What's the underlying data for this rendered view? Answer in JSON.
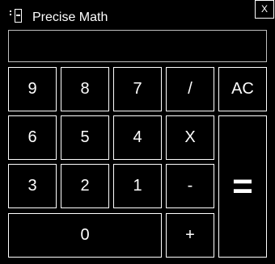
{
  "window": {
    "title": "Precise Math",
    "close_label": "X",
    "icon": "calculator-icon"
  },
  "display": {
    "value": ""
  },
  "keys": {
    "nine": "9",
    "eight": "8",
    "seven": "7",
    "divide": "/",
    "clear": "AC",
    "six": "6",
    "five": "5",
    "four": "4",
    "multiply": "X",
    "three": "3",
    "two": "2",
    "one": "1",
    "subtract": "-",
    "equals": "=",
    "zero": "0",
    "add": "+"
  },
  "colors": {
    "background": "#000000",
    "foreground": "#ffffff",
    "display_border": "#bfbfbf"
  }
}
